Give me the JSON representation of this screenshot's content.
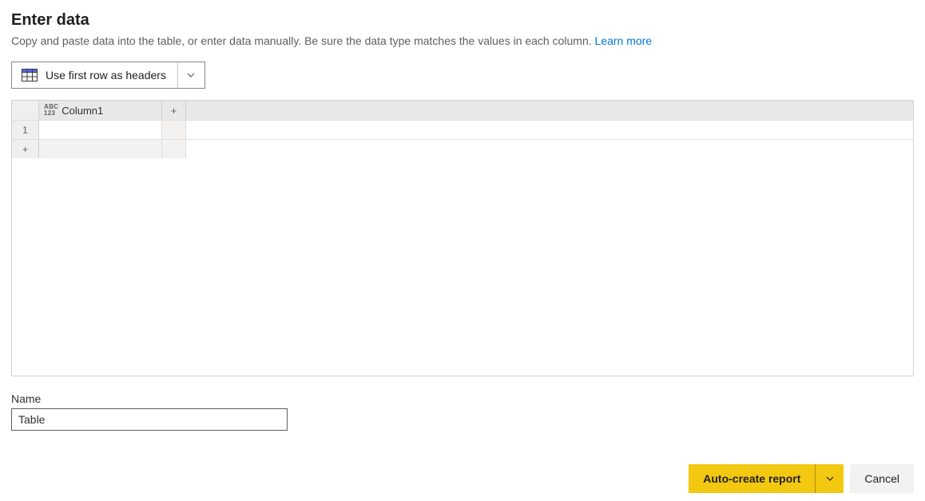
{
  "title": "Enter data",
  "subtitle": "Copy and paste data into the table, or enter data manually. Be sure the data type matches the values in each column. ",
  "learn_more": "Learn more",
  "headers_button": {
    "label": "Use first row as headers"
  },
  "grid": {
    "type_indicator_top": "ABC",
    "type_indicator_bottom": "123",
    "columns": [
      "Column1"
    ],
    "rows": [
      {
        "index": "1",
        "cells": [
          ""
        ]
      }
    ],
    "add_col_glyph": "+",
    "add_row_glyph": "+"
  },
  "name_field": {
    "label": "Name",
    "value": "Table"
  },
  "footer": {
    "primary_label": "Auto-create report",
    "cancel_label": "Cancel"
  }
}
